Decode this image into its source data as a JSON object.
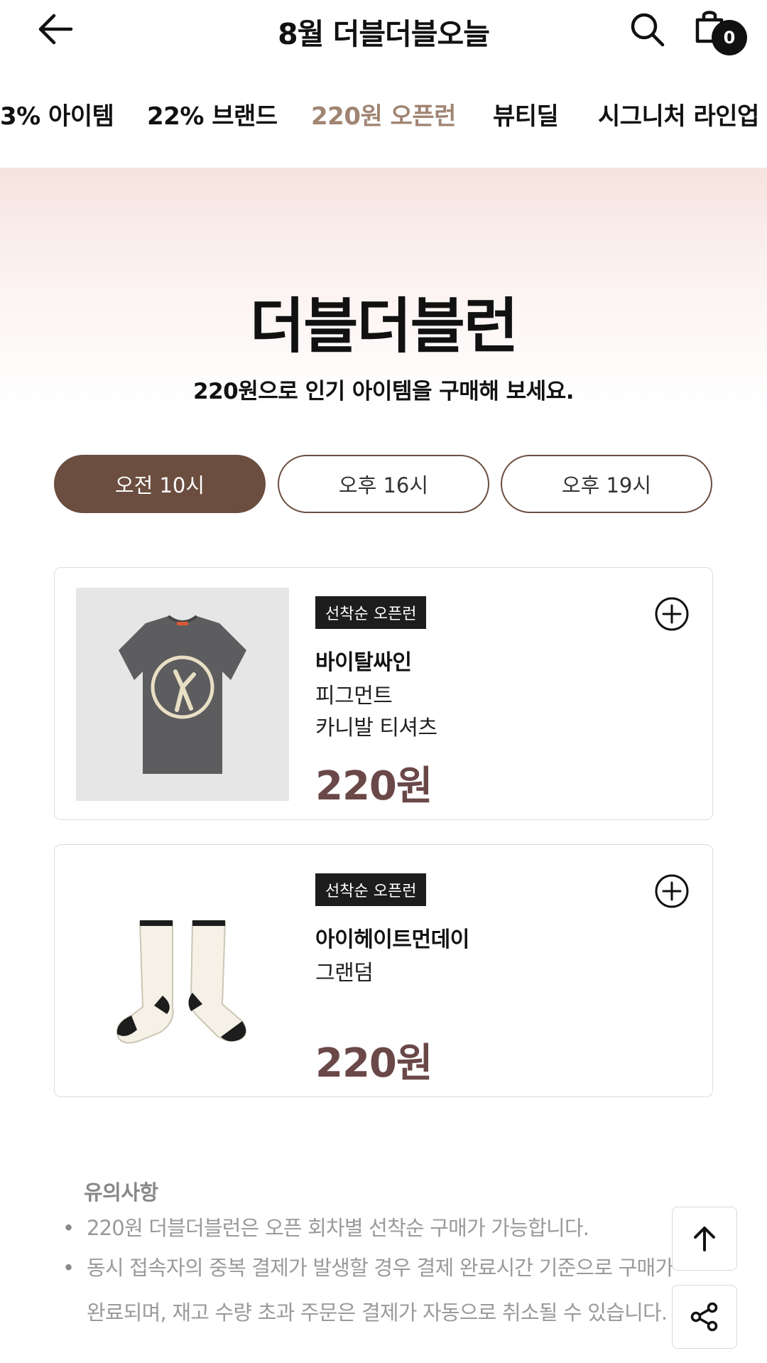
{
  "header": {
    "title": "8월 더블더블오늘",
    "cart_count": "0"
  },
  "tabs": [
    {
      "label": "3% 아이템"
    },
    {
      "label": "22% 브랜드"
    },
    {
      "label": "220원 오픈런"
    },
    {
      "label": "뷰티딜"
    },
    {
      "label": "시그니처 라인업"
    }
  ],
  "active_tab_color": "#a08573",
  "hero": {
    "title": "더블더블런",
    "subtitle": "220원으로 인기 아이템을 구매해 보세요."
  },
  "times": [
    {
      "label": "오전 10시",
      "selected": true
    },
    {
      "label": "오후 16시",
      "selected": false
    },
    {
      "label": "오후 19시",
      "selected": false
    }
  ],
  "products": [
    {
      "badge": "선착순 오픈런",
      "brand": "바이탈싸인",
      "name_lines": [
        "피그먼트",
        "카니발 티셔츠"
      ],
      "price": "220원",
      "image": "gray-tshirt"
    },
    {
      "badge": "선착순 오픈런",
      "brand": "아이헤이트먼데이",
      "name_lines": [
        "그랜덤"
      ],
      "price": "220원",
      "image": "cream-socks"
    }
  ],
  "notice": {
    "title": "유의사항",
    "items": [
      "220원 더블더블런은 오픈 회차별 선착순 구매가 가능합니다.",
      "동시 접속자의 중복 결제가 발생할 경우 결제 완료시간 기준으로 구매가"
    ],
    "continuation": "완료되며, 재고 수량 초과 주문은 결제가 자동으로 취소될 수 있습니다."
  },
  "colors": {
    "brand_brown": "#6b4e3f",
    "price": "#6b4848"
  }
}
